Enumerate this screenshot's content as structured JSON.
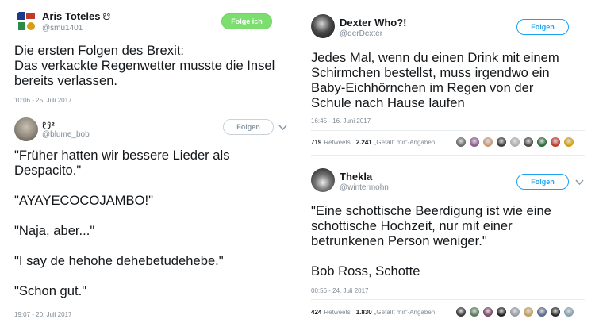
{
  "tweets": [
    {
      "name": "Aris Toteles",
      "badge": "☋",
      "handle": "@smu1401",
      "follow_label": "Folge ich",
      "text": "Die ersten Folgen des Brexit:\nDas verkackte Regenwetter musste die Insel\nbereits verlassen.",
      "time": "10:06 - 25. Juli 2017"
    },
    {
      "name": "☋²",
      "handle": "@blume_bob",
      "follow_label": "Folgen",
      "text": "\"Früher hatten wir bessere Lieder als\nDespacito.\"\n\n\"AYAYECOCOJAMBO!\"\n\n\"Naja, aber...\"\n\n\"I say de hehohe dehebetudehebe.\"\n\n\"Schon gut.\"",
      "time": "19:07 - 20. Juli 2017"
    },
    {
      "name": "Dexter Who?!",
      "handle": "@derDexter",
      "follow_label": "Folgen",
      "text": "Jedes Mal, wenn du einen Drink mit einem\nSchirmchen bestellst, muss irgendwo ein\nBaby-Eichhörnchen im Regen von der\nSchule nach Hause laufen",
      "time": "16:45 - 16. Juni 2017",
      "retweets": "719",
      "retweets_label": "Retweets",
      "likes": "2.241",
      "likes_label": "„Gefällt mir“-Angaben",
      "liker_colors": [
        "#6b6b6b",
        "#8a5a8c",
        "#c89b7a",
        "#3a3a3a",
        "#b0b0b0",
        "#4a4a4a",
        "#2d6a3a",
        "#c0392b",
        "#d4a017"
      ]
    },
    {
      "name": "Thekla",
      "handle": "@wintermohn",
      "follow_label": "Folgen",
      "text": "\"Eine schottische Beerdigung ist wie eine\nschottische Hochzeit, nur mit einer\nbetrunkenen Person weniger.\"\n\nBob Ross, Schotte",
      "time": "00:56 - 24. Juli 2017",
      "retweets": "424",
      "retweets_label": "Retweets",
      "likes": "1.830",
      "likes_label": "„Gefällt mir“-Angaben",
      "liker_colors": [
        "#3b3b3b",
        "#5a7a5a",
        "#7a4a6a",
        "#222",
        "#9a9aaa",
        "#c0a060",
        "#5a6a8a",
        "#2a2a2a",
        "#8aa0b0"
      ]
    }
  ]
}
